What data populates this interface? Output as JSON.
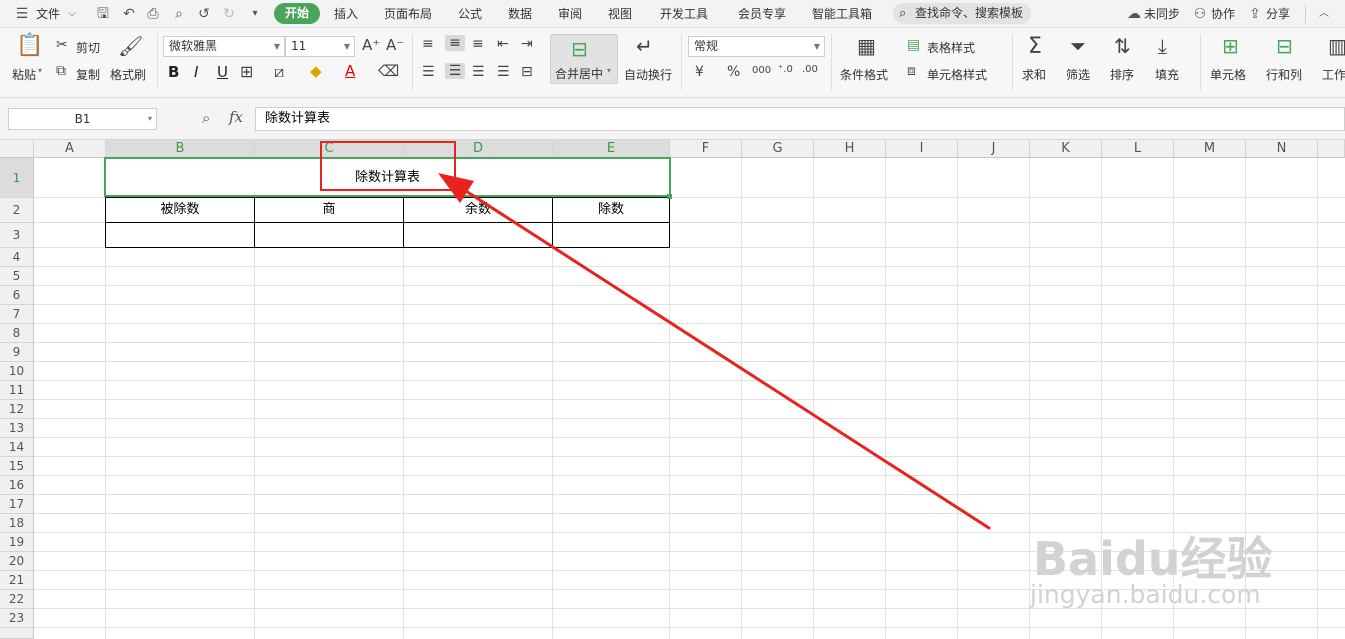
{
  "menubar": {
    "file": "文件",
    "tabs": [
      "开始",
      "插入",
      "页面布局",
      "公式",
      "数据",
      "审阅",
      "视图",
      "开发工具",
      "会员专享",
      "智能工具箱"
    ],
    "search": "查找命令、搜索模板",
    "sync": "未同步",
    "collab": "协作",
    "share": "分享"
  },
  "ribbon": {
    "paste": "粘贴",
    "cut": "剪切",
    "copy": "复制",
    "format_painter": "格式刷",
    "font_name": "微软雅黑",
    "font_size": "11",
    "merge_center": "合并居中",
    "wrap_text": "自动换行",
    "number_format": "常规",
    "conditional_format": "条件格式",
    "table_style": "表格样式",
    "cell_style": "单元格样式",
    "sum": "求和",
    "filter": "筛选",
    "sort": "排序",
    "fill": "填充",
    "cell": "单元格",
    "rows_cols": "行和列",
    "worksheet": "工作"
  },
  "formula": {
    "cell_ref": "B1",
    "fx": "fx",
    "value": "除数计算表"
  },
  "columns": [
    "A",
    "B",
    "C",
    "D",
    "E",
    "F",
    "G",
    "H",
    "I",
    "J",
    "K",
    "L",
    "M",
    "N"
  ],
  "rows": [
    "1",
    "2",
    "3",
    "4",
    "5",
    "6",
    "7",
    "8",
    "9",
    "10",
    "11",
    "12",
    "13",
    "14",
    "15",
    "16",
    "17",
    "18",
    "19",
    "20",
    "21",
    "22",
    "23"
  ],
  "sheet": {
    "title": "除数计算表",
    "headers": [
      "被除数",
      "商",
      "余数",
      "除数"
    ]
  },
  "watermark": {
    "brand": "Baidu经验",
    "url": "jingyan.baidu.com"
  },
  "colors": {
    "accent_green": "#4aa55c",
    "annotation_red": "#e8231e"
  }
}
